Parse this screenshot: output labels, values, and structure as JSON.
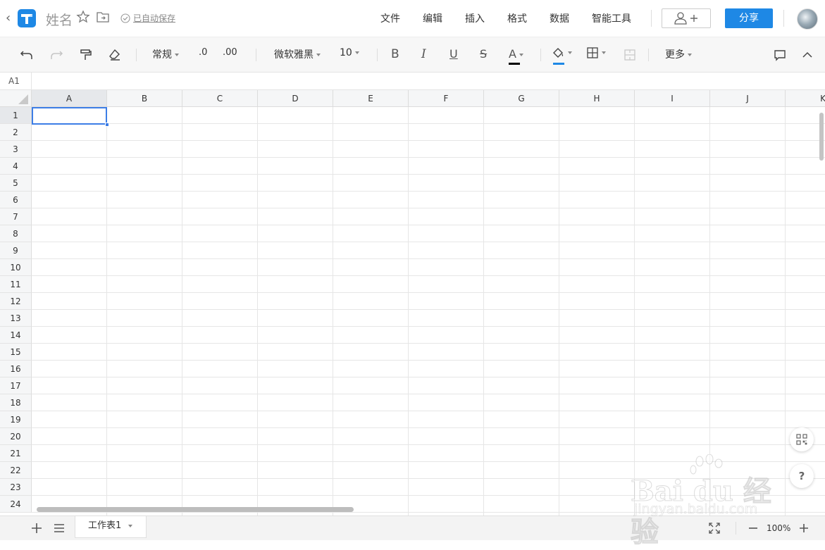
{
  "header": {
    "title": "姓名",
    "save_status": "已自动保存",
    "menus": [
      "文件",
      "编辑",
      "插入",
      "格式",
      "数据",
      "智能工具"
    ],
    "share_label": "分享"
  },
  "toolbar": {
    "number_format": "常规",
    "decimal_decrease": ".0",
    "decimal_increase": ".00",
    "font_name": "微软雅黑",
    "font_size": "10",
    "bold": "B",
    "italic": "I",
    "underline": "U",
    "strike": "S",
    "font_color_letter": "A",
    "font_color": "#000000",
    "fill_color": "#1e88e5",
    "more_label": "更多"
  },
  "formula_bar": {
    "cell_ref": "A1"
  },
  "sheet": {
    "columns": [
      "A",
      "B",
      "C",
      "D",
      "E",
      "F",
      "G",
      "H",
      "I",
      "J",
      "K"
    ],
    "rows": [
      "1",
      "2",
      "3",
      "4",
      "5",
      "6",
      "7",
      "8",
      "9",
      "10",
      "11",
      "12",
      "13",
      "14",
      "15",
      "16",
      "17",
      "18",
      "19",
      "20",
      "21",
      "22",
      "23",
      "24"
    ],
    "selected_cell": "A1"
  },
  "sheet_tabs": [
    {
      "label": "工作表1",
      "active": true
    }
  ],
  "zoom": {
    "level": "100%"
  },
  "float_buttons": {
    "help_label": "?"
  },
  "watermark": {
    "main": "Bai du 经验",
    "sub": "jingyan.baidu.com"
  },
  "colors": {
    "accent": "#1e88e5",
    "selection": "#3d7ee6"
  }
}
